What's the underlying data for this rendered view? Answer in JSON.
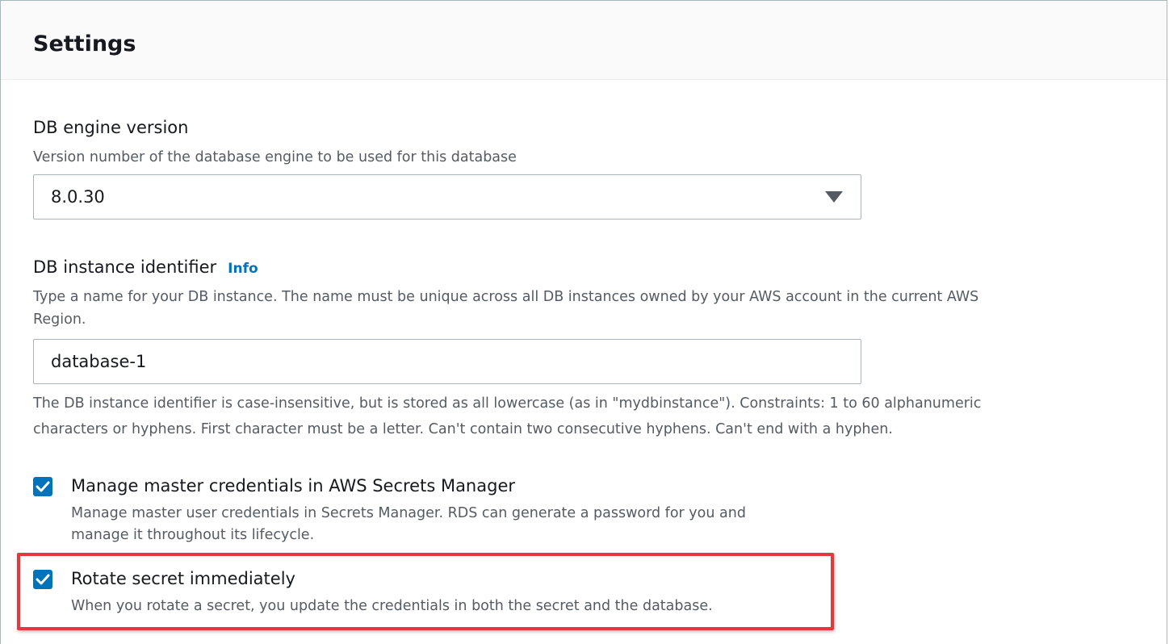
{
  "settings": {
    "title": "Settings"
  },
  "engine_version": {
    "label": "DB engine version",
    "description": "Version number of the database engine to be used for this database",
    "selected": "8.0.30"
  },
  "instance_identifier": {
    "label": "DB instance identifier",
    "info_link": "Info",
    "description_line1": "Type a name for your DB instance. The name must be unique across all DB instances owned by your AWS account in the current AWS",
    "description_line2": "Region.",
    "value": "database-1",
    "constraint_line1": "The DB instance identifier is case-insensitive, but is stored as all lowercase (as in \"mydbinstance\"). Constraints: 1 to 60 alphanumeric",
    "constraint_line2": "characters or hyphens. First character must be a letter. Can't contain two consecutive hyphens. Can't end with a hyphen."
  },
  "manage_credentials": {
    "checked": true,
    "label": "Manage master credentials in AWS Secrets Manager",
    "description_line1": "Manage master user credentials in Secrets Manager. RDS can generate a password for you and",
    "description_line2": "manage it throughout its lifecycle."
  },
  "rotate_secret": {
    "checked": true,
    "label": "Rotate secret immediately",
    "description": "When you rotate a secret, you update the credentials in both the secret and the database."
  },
  "colors": {
    "accent": "#0073bb",
    "highlight": "#e3393a",
    "text_primary": "#16191f",
    "text_secondary": "#545b64",
    "border": "#aab7b8"
  }
}
